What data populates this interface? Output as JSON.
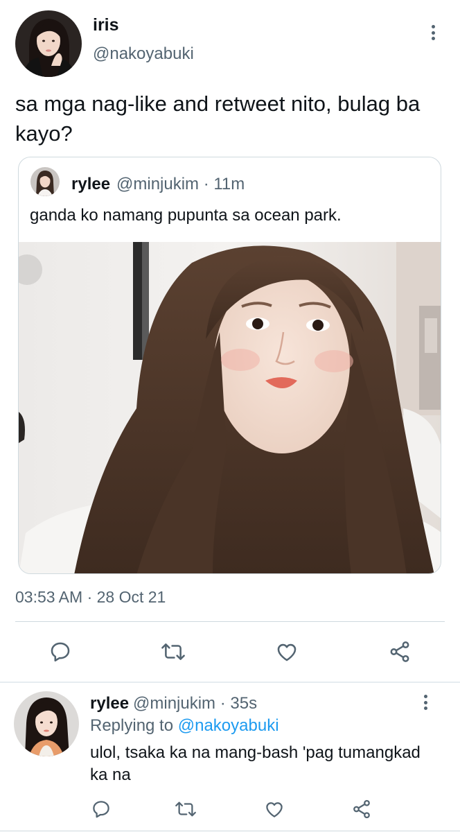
{
  "tweet": {
    "author_name": "iris",
    "author_handle": "@nakoyabuki",
    "text": "sa mga nag-like and retweet nito, bulag ba kayo?",
    "timestamp": "03:53 AM · 28 Oct 21"
  },
  "quoted_tweet": {
    "author_name": "rylee",
    "author_handle": "@minjukim · 11m",
    "text": "ganda ko namang pupunta sa ocean park."
  },
  "reply": {
    "author_name": "rylee",
    "author_handle": "@minjukim · 35s",
    "replying_prefix": "Replying to ",
    "replying_handle": "@nakoyabuki",
    "text": "ulol, tsaka ka na mang-bash 'pag tumangkad ka na"
  },
  "icons": {
    "more": "more-vertical-icon",
    "reply": "reply-icon",
    "retweet": "retweet-icon",
    "like": "heart-icon",
    "share": "share-icon"
  },
  "colors": {
    "text": "#0f1419",
    "secondary": "#536471",
    "link": "#1d9bf0",
    "border": "#cfd9de"
  }
}
